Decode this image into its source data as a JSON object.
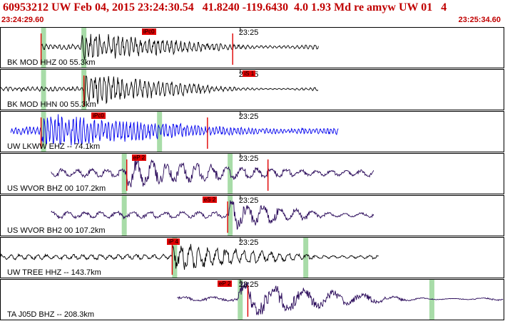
{
  "header": {
    "title": "60953212 UW Feb 04, 2015 23:24:30.54   41.8240 -119.6430  4.0 1.93 Md re amyw UW 01   4",
    "start_time": "23:24:29.60",
    "end_time": "23:25:34.60"
  },
  "minute_label": "23:25",
  "colors": {
    "header": "#c00000",
    "pick": "#e00000",
    "trace_default": "#000000",
    "trace_blue": "#0000ee",
    "trace_purple": "#2a0a5a",
    "window": "#a8dca8"
  },
  "traces": [
    {
      "channel": "BK MOD HHZ 00 55.3km",
      "color": "#000000",
      "pick_label": "iPc0",
      "pick_time": 28.0,
      "minute_time": 22.0,
      "signal_start": 8.0,
      "signal_end": 63.0,
      "onset": 16.0,
      "amp": 0.55,
      "noise": 0.12,
      "freq": 4.0,
      "wins": [
        8.0,
        16.0
      ],
      "red_lines": [
        8.0,
        46.0
      ]
    },
    {
      "channel": "BK MOD HHN 00 55.3km",
      "color": "#000000",
      "pick_label": "iS 1",
      "pick_time": 48.0,
      "minute_time": 22.0,
      "signal_start": 0.0,
      "signal_end": 63.0,
      "onset": 16.5,
      "amp": 0.65,
      "noise": 0.1,
      "freq": 4.0,
      "wins": [
        8.0,
        16.0
      ],
      "red_lines": [
        16.5
      ]
    },
    {
      "channel": "UW LKWW EHZ -- 74.1km",
      "color": "#0000ee",
      "pick_label": "iPc0",
      "pick_time": 18.0,
      "minute_time": 22.0,
      "signal_start": 2.0,
      "signal_end": 67.0,
      "onset": 8.0,
      "amp": 0.6,
      "noise": 0.18,
      "freq": 5.0,
      "wins": [
        8.0,
        31.0
      ],
      "red_lines": [
        8.0,
        41.0
      ]
    },
    {
      "channel": "US WVOR BHZ 00 107.2km",
      "color": "#2a0a5a",
      "pick_label": "eP 2",
      "pick_time": 26.0,
      "minute_time": 22.0,
      "signal_start": 10.0,
      "signal_end": 74.0,
      "onset": 25.0,
      "amp": 0.5,
      "noise": 0.18,
      "freq": 1.2,
      "wins": [
        24.0,
        45.0
      ],
      "red_lines": [
        25.0,
        53.0
      ]
    },
    {
      "channel": "US WVOR BH2 00 107.2km",
      "color": "#2a0a5a",
      "pick_label": "eS 2",
      "pick_time": 40.0,
      "minute_time": 22.0,
      "signal_start": 10.0,
      "signal_end": 74.0,
      "onset": 45.0,
      "amp": 0.55,
      "noise": 0.15,
      "freq": 1.1,
      "wins": [
        24.0,
        45.0
      ],
      "red_lines": [
        45.0
      ]
    },
    {
      "channel": "UW TREE HHZ -- 143.7km",
      "color": "#000000",
      "pick_label": "iP 4",
      "pick_time": 33.0,
      "minute_time": 22.0,
      "signal_start": 0.0,
      "signal_end": 75.0,
      "onset": 34.0,
      "amp": 0.55,
      "noise": 0.12,
      "freq": 2.0,
      "wins": [
        34.0,
        60.0
      ],
      "red_lines": [
        34.0
      ]
    },
    {
      "channel": "TA J05D BHZ -- 208.3km",
      "color": "#2a0a5a",
      "pick_label": "eP 2",
      "pick_time": 43.0,
      "minute_time": 22.0,
      "signal_start": 35.0,
      "signal_end": 100.0,
      "onset": 47.0,
      "amp": 0.7,
      "noise": 0.1,
      "freq": 0.6,
      "wins": [
        47.0,
        85.0
      ],
      "red_lines": [
        49.0
      ]
    }
  ]
}
